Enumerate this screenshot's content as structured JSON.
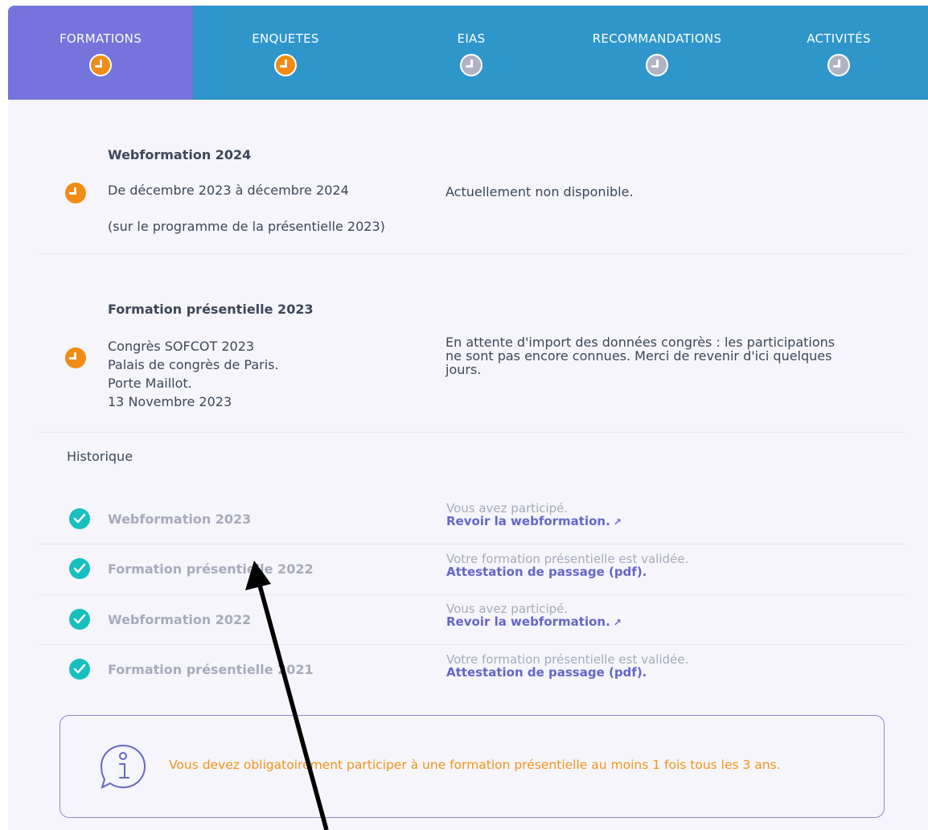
{
  "tabs": [
    {
      "label": "FORMATIONS",
      "status": "orange",
      "active": true
    },
    {
      "label": "ENQUETES",
      "status": "orange",
      "active": false
    },
    {
      "label": "EIAS",
      "status": "gray",
      "active": false
    },
    {
      "label": "RECOMMANDATIONS",
      "status": "gray",
      "active": false
    },
    {
      "label": "ACTIVITÉS",
      "status": "gray",
      "active": false
    }
  ],
  "current": [
    {
      "title": "Webformation 2024",
      "lines": [
        "De décembre 2023 à décembre 2024",
        "(sur le programme de la présentielle 2023)"
      ],
      "status": "Actuellement non disponible."
    },
    {
      "title": "Formation présentielle 2023",
      "lines": [
        "Congrès SOFCOT 2023",
        "Palais de congrès de Paris.",
        "Porte Maillot.",
        "13 Novembre 2023"
      ],
      "status_lines": [
        "En attente d'import des données congrès : les participations",
        "ne sont pas encore connues. Merci de revenir d'ici quelques",
        "jours."
      ]
    }
  ],
  "history_title": "Historique",
  "history": [
    {
      "name": "Webformation 2023",
      "status": "Vous avez participé.",
      "link": "Revoir la webformation.",
      "external": "↗"
    },
    {
      "name": "Formation présentielle 2022",
      "status": "Votre formation présentielle est validée.",
      "link": "Attestation de passage (pdf).",
      "external": ""
    },
    {
      "name": "Webformation 2022",
      "status": "Vous avez participé.",
      "link": "Revoir la webformation.",
      "external": "↗"
    },
    {
      "name": "Formation présentielle 2021",
      "status": "Votre formation présentielle est validée.",
      "link": "Attestation de passage (pdf).",
      "external": ""
    }
  ],
  "info": {
    "text": "Vous devez obligatoirement participer à une formation présentielle au moins 1 fois tous les 3 ans."
  },
  "colors": {
    "tab_bg": "#2e96cb",
    "tab_active": "#7474dc",
    "orange": "#f08c15",
    "teal": "#17bfbf",
    "link": "#6566c9",
    "info_text": "#f29318"
  }
}
